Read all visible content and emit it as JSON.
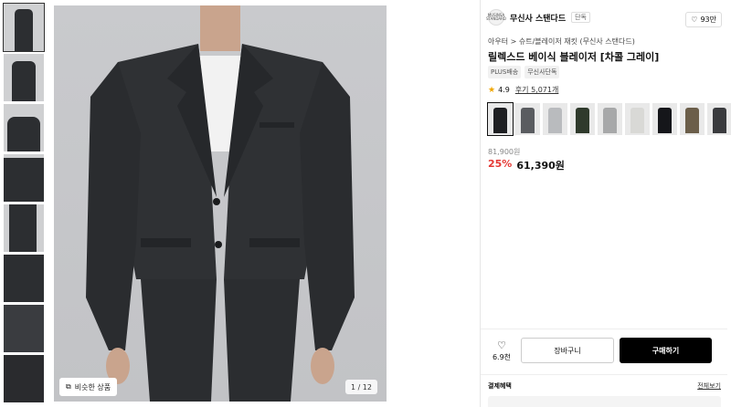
{
  "gallery": {
    "similar_label": "비슷한 상품",
    "counter": "1 / 12",
    "thumbnail_count": 8
  },
  "brand": {
    "logo_text": "MUSINSA STANDARD",
    "name": "무신사 스탠다드",
    "tag": "단독"
  },
  "like": {
    "count": "93만"
  },
  "breadcrumb": "아우터 > 슈트/블레이저 재킷 (무신사 스탠다드)",
  "product": {
    "title": "릴렉스드 베이식 블레이저 [차콜 그레이]",
    "badges": [
      "PLUS배송",
      "무신사단독"
    ],
    "rating": "4.9",
    "reviews": "후기 5,071개"
  },
  "swatches": [
    "#1e1f22",
    "#5a5c60",
    "#b9bbbe",
    "#2f3a2c",
    "#a7a8a9",
    "#d9d9d6",
    "#15161a",
    "#6b5e4a",
    "#3a3b3e"
  ],
  "price": {
    "original": "81,900원",
    "discount": "25%",
    "final": "61,390원"
  },
  "actions": {
    "wish_count": "6.9천",
    "cart_label": "장바구니",
    "buy_label": "구매하기"
  },
  "benefits": {
    "title": "결제혜택",
    "all_label": "전체보기"
  }
}
